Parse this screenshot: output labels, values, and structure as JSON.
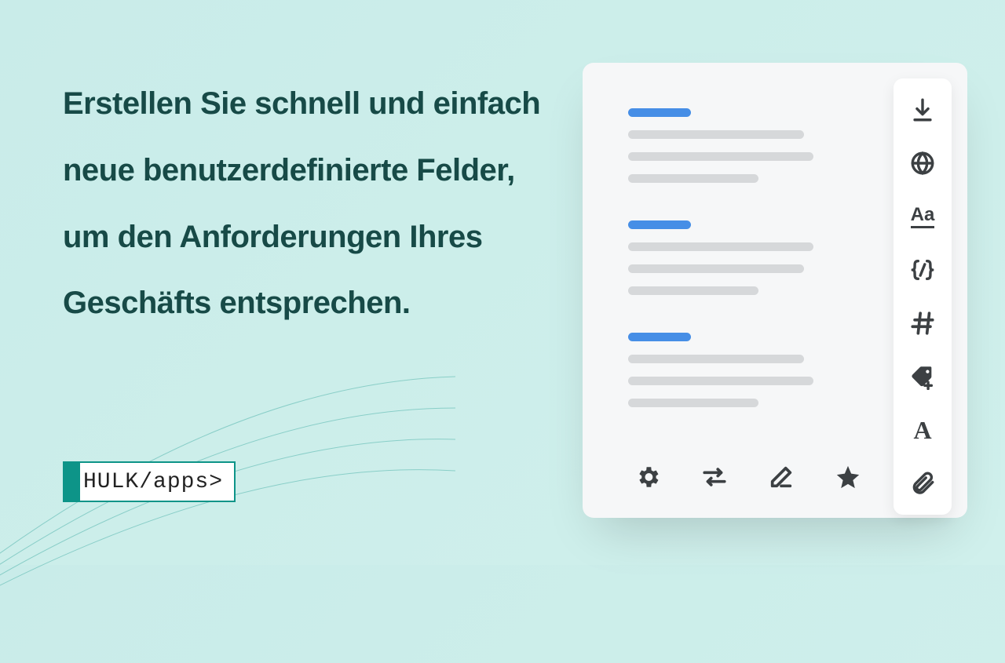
{
  "headline": "Erstellen Sie schnell und einfach neue benutzerdefinierte Felder, um den Anforderungen Ihres Geschäfts entsprechen.",
  "brand": {
    "name": "HULK/apps>"
  },
  "colors": {
    "accent": "#468ee6",
    "brand": "#0d9488",
    "text_dark": "#174a47",
    "icon": "#3c4043"
  },
  "side_tools": [
    {
      "name": "download-icon"
    },
    {
      "name": "globe-icon"
    },
    {
      "name": "typography-icon"
    },
    {
      "name": "code-icon"
    },
    {
      "name": "hash-icon"
    },
    {
      "name": "tag-add-icon"
    },
    {
      "name": "font-icon"
    },
    {
      "name": "attachment-icon"
    }
  ],
  "bottom_tools": [
    {
      "name": "settings-icon"
    },
    {
      "name": "swap-icon"
    },
    {
      "name": "edit-icon"
    },
    {
      "name": "star-icon"
    }
  ]
}
